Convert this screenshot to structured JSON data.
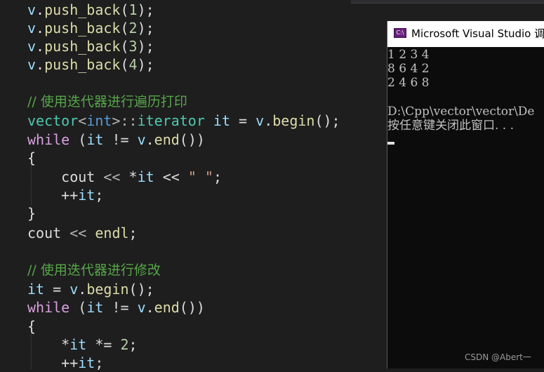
{
  "editor": {
    "lines": [
      {
        "var1": "v",
        "dot": ".",
        "fn": "push_back",
        "p1": "(",
        "num": "1",
        "p2": ");"
      },
      {
        "var1": "v",
        "dot": ".",
        "fn": "push_back",
        "p1": "(",
        "num": "2",
        "p2": ");"
      },
      {
        "var1": "v",
        "dot": ".",
        "fn": "push_back",
        "p1": "(",
        "num": "3",
        "p2": ");"
      },
      {
        "var1": "v",
        "dot": ".",
        "fn": "push_back",
        "p1": "(",
        "num": "4",
        "p2": ");"
      }
    ],
    "comment_traverse": "// 使用迭代器进行遍历打印",
    "decl": {
      "cls": "vector",
      "lt": "<",
      "type": "int",
      "gt": ">::",
      "cls2": "iterator",
      "sp": " ",
      "var": "it",
      "eq": " = ",
      "var2": "v",
      "dot": ".",
      "fn": "begin",
      "end": "();"
    },
    "while1": {
      "kw": "while",
      "open": " (",
      "var": "it",
      "op": " != ",
      "var2": "v",
      "dot": ".",
      "fn": "end",
      "close": "())"
    },
    "brace_open": "{",
    "cout_line": {
      "pre": "    cout ",
      "op": "<<",
      "star": " *",
      "var": "it",
      "op2": " << ",
      "str": "\" \"",
      "end": ";"
    },
    "inc_line": {
      "pre": "    ",
      "op": "++",
      "var": "it",
      "end": ";"
    },
    "brace_close": "}",
    "endl_line": {
      "pre": "cout ",
      "op": "<<",
      "sp": " ",
      "fn": "endl",
      "end": ";"
    },
    "comment_modify": "// 使用迭代器进行修改",
    "assign": {
      "var": "it",
      "eq": " = ",
      "var2": "v",
      "dot": ".",
      "fn": "begin",
      "end": "();"
    },
    "while2": {
      "kw": "while",
      "open": " (",
      "var": "it",
      "op": " != ",
      "var2": "v",
      "dot": ".",
      "fn": "end",
      "close": "())"
    },
    "brace_open2": "{",
    "mul_line": {
      "pre": "    *",
      "var": "it",
      "op": " *= ",
      "num": "2",
      "end": ";"
    },
    "inc_line2": {
      "pre": "    ",
      "op": "++",
      "var": "it",
      "end": ";"
    }
  },
  "console": {
    "title": "Microsoft Visual Studio 调",
    "icon_label": "C:\\",
    "output": [
      "1 2 3 4",
      "8 6 4 2",
      "2 4 6 8",
      "",
      "D:\\Cpp\\vector\\vector\\De",
      "按任意键关闭此窗口. . ."
    ]
  },
  "watermark": "CSDN @Abert一"
}
